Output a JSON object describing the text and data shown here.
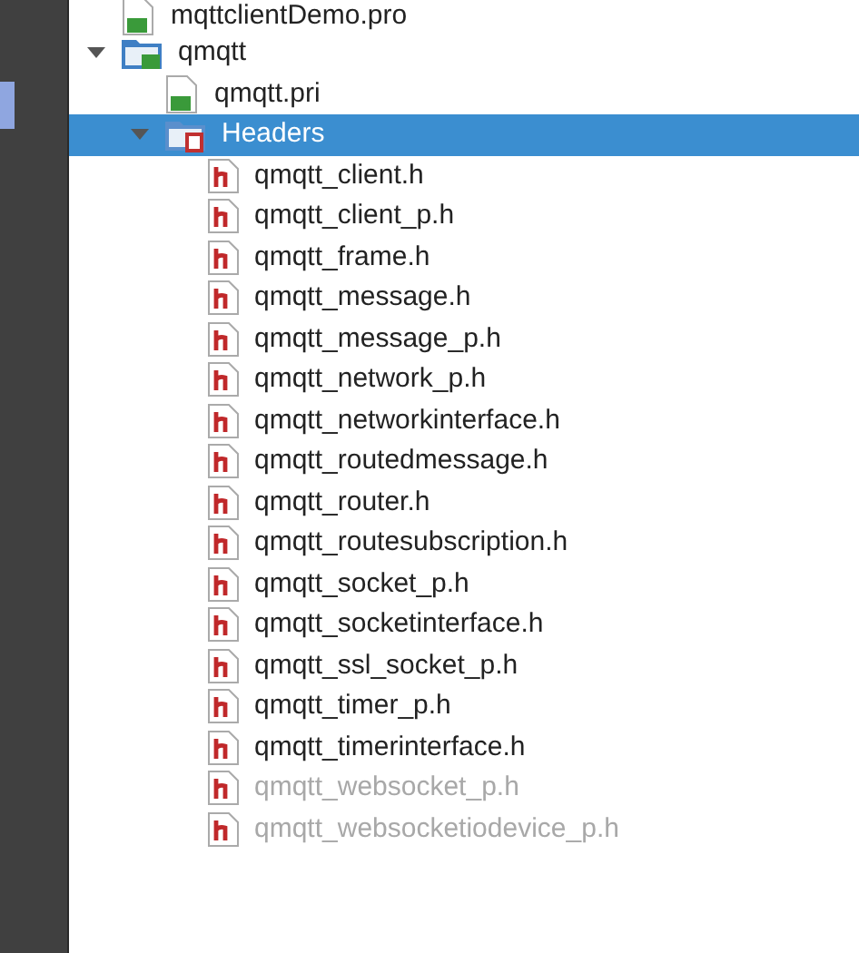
{
  "tree": [
    {
      "name": "mqttclientDemo.pro",
      "kind": "pro",
      "selected": false
    },
    {
      "name": "qmqtt",
      "kind": "project",
      "expanded": true,
      "selected": false,
      "children": [
        {
          "name": "qmqtt.pri",
          "kind": "pri",
          "selected": false
        },
        {
          "name": "Headers",
          "kind": "folder",
          "expanded": true,
          "selected": true,
          "children": [
            {
              "name": "qmqtt_client.h",
              "kind": "header",
              "selected": false,
              "disabled": false
            },
            {
              "name": "qmqtt_client_p.h",
              "kind": "header",
              "selected": false,
              "disabled": false
            },
            {
              "name": "qmqtt_frame.h",
              "kind": "header",
              "selected": false,
              "disabled": false
            },
            {
              "name": "qmqtt_message.h",
              "kind": "header",
              "selected": false,
              "disabled": false
            },
            {
              "name": "qmqtt_message_p.h",
              "kind": "header",
              "selected": false,
              "disabled": false
            },
            {
              "name": "qmqtt_network_p.h",
              "kind": "header",
              "selected": false,
              "disabled": false
            },
            {
              "name": "qmqtt_networkinterface.h",
              "kind": "header",
              "selected": false,
              "disabled": false
            },
            {
              "name": "qmqtt_routedmessage.h",
              "kind": "header",
              "selected": false,
              "disabled": false
            },
            {
              "name": "qmqtt_router.h",
              "kind": "header",
              "selected": false,
              "disabled": false
            },
            {
              "name": "qmqtt_routesubscription.h",
              "kind": "header",
              "selected": false,
              "disabled": false
            },
            {
              "name": "qmqtt_socket_p.h",
              "kind": "header",
              "selected": false,
              "disabled": false
            },
            {
              "name": "qmqtt_socketinterface.h",
              "kind": "header",
              "selected": false,
              "disabled": false
            },
            {
              "name": "qmqtt_ssl_socket_p.h",
              "kind": "header",
              "selected": false,
              "disabled": false
            },
            {
              "name": "qmqtt_timer_p.h",
              "kind": "header",
              "selected": false,
              "disabled": false
            },
            {
              "name": "qmqtt_timerinterface.h",
              "kind": "header",
              "selected": false,
              "disabled": false
            },
            {
              "name": "qmqtt_websocket_p.h",
              "kind": "header",
              "selected": false,
              "disabled": true
            },
            {
              "name": "qmqtt_websocketiodevice_p.h",
              "kind": "header",
              "selected": false,
              "disabled": true
            }
          ]
        }
      ]
    }
  ]
}
